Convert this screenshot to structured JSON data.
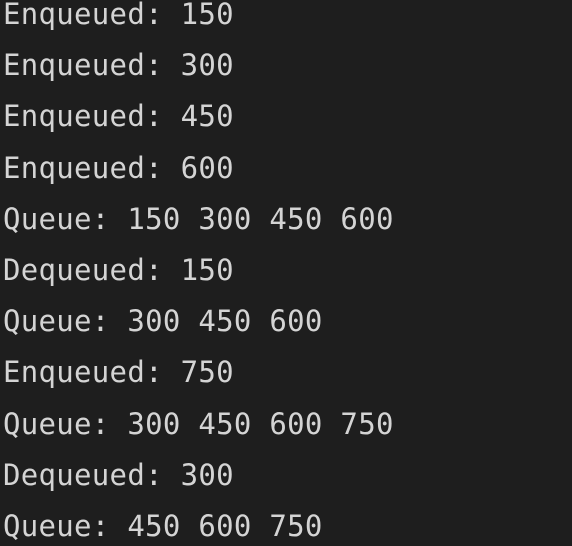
{
  "terminal": {
    "lines": [
      "Enqueued: 150",
      "Enqueued: 300",
      "Enqueued: 450",
      "Enqueued: 600",
      "Queue: 150 300 450 600",
      "Dequeued: 150",
      "Queue: 300 450 600",
      "Enqueued: 750",
      "Queue: 300 450 600 750",
      "Dequeued: 300",
      "Queue: 450 600 750"
    ]
  },
  "colors": {
    "background": "#1e1e1e",
    "text": "#d4d4d4"
  }
}
